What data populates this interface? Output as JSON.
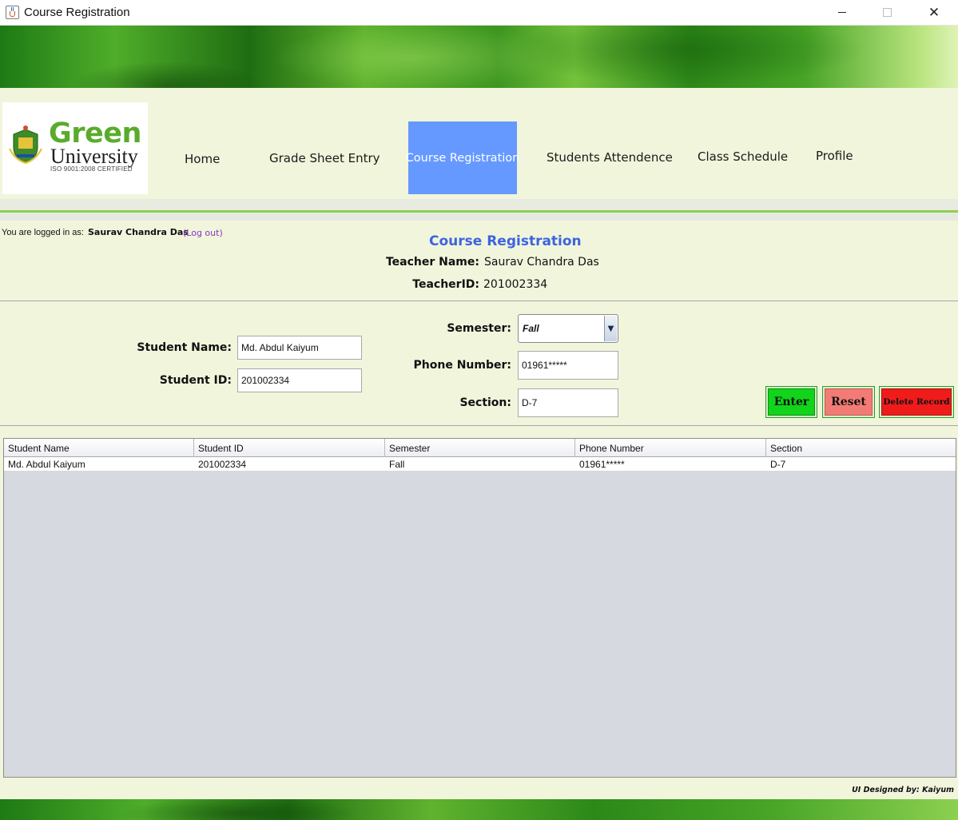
{
  "window": {
    "title": "Course Registration",
    "close_glyph": "✕"
  },
  "logo": {
    "line1": "Green",
    "line2": "University",
    "line3": "ISO 9001:2008 CERTIFIED",
    "crest_text": "Green University"
  },
  "nav": {
    "items": [
      {
        "label": "Home"
      },
      {
        "label": "Grade Sheet Entry"
      },
      {
        "label": "Course Registration",
        "active": true
      },
      {
        "label": "Students Attendence"
      },
      {
        "label": "Class Schedule"
      },
      {
        "label": "Profile"
      }
    ],
    "active_color": "#6699ff"
  },
  "session": {
    "logged_in_label": "You are logged in as:",
    "user_name": "Saurav Chandra Das",
    "logout_label": "(Log out)"
  },
  "heading": {
    "title": "Course Registration",
    "teacher_name_label": "Teacher Name:",
    "teacher_name_value": "Saurav Chandra Das",
    "teacher_id_label": "TeacherID:",
    "teacher_id_value": "201002334"
  },
  "form": {
    "student_name_label": "Student Name:",
    "student_name_value": "Md. Abdul Kaiyum",
    "student_id_label": "Student ID:",
    "student_id_value": "201002334",
    "semester_label": "Semester:",
    "semester_value": "Fall",
    "phone_label": "Phone Number:",
    "phone_value": "01961*****",
    "section_label": "Section:",
    "section_value": "D-7"
  },
  "buttons": {
    "enter": "Enter",
    "reset": "Reset",
    "delete": "Delete Record",
    "enter_color": "#11d41b",
    "reset_color": "#f37b76",
    "delete_color": "#f01c1c"
  },
  "table": {
    "columns": [
      "Student Name",
      "Student ID",
      "Semester",
      "Phone Number",
      "Section"
    ],
    "rows": [
      [
        "Md. Abdul Kaiyum",
        "201002334",
        "Fall",
        "01961*****",
        "D-7"
      ]
    ]
  },
  "footer": {
    "credit": "UI Designed by: Kaiyum"
  },
  "theme": {
    "background": "#f1f5dc",
    "accent_green": "#8fcf4e",
    "heading_blue": "#3c64e0"
  }
}
